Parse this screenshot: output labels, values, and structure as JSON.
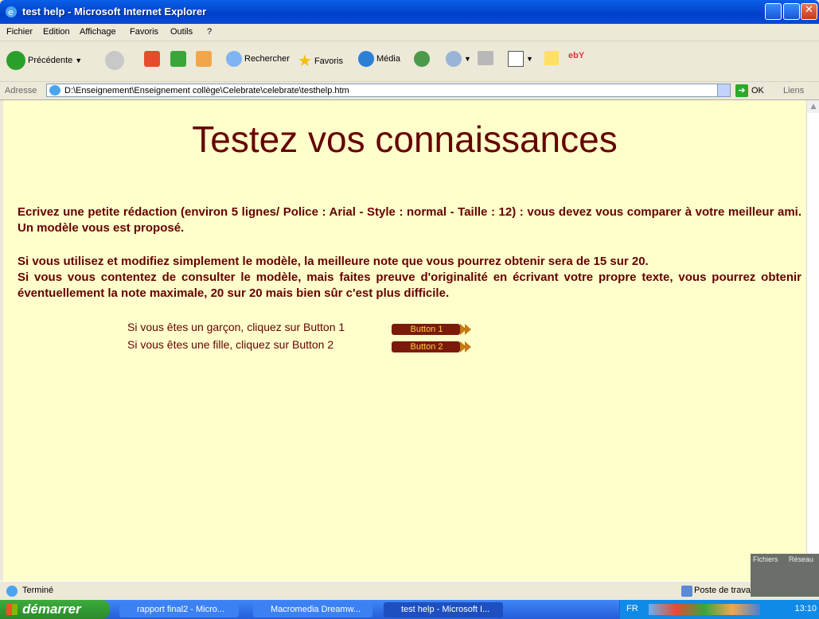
{
  "window": {
    "title": "test help - Microsoft Internet Explorer"
  },
  "menu": [
    "Fichier",
    "Edition",
    "Affichage",
    "Favoris",
    "Outils",
    "?"
  ],
  "toolbar": {
    "back_label": "Précédente",
    "search_label": "Rechercher",
    "favorites_label": "Favoris",
    "media_label": "Média",
    "ebay_label": "ebY"
  },
  "address": {
    "label": "Adresse",
    "url": "D:\\Enseignement\\Enseignement collège\\Celebrate\\celebrate\\testhelp.htm",
    "go_label": "OK",
    "links_label": "Liens"
  },
  "page": {
    "heading": "Testez vos connaissances",
    "paragraph1": "Ecrivez une petite rédaction (environ 5 lignes/ Police : Arial - Style : normal - Taille : 12) : vous devez vous comparer à votre meilleur ami. Un modèle vous est proposé.",
    "paragraph2": "Si vous utilisez et modifiez simplement le modèle, la meilleure note que vous pourrez obtenir sera de 15 sur 20.",
    "paragraph3": "Si vous vous contentez de consulter le modèle, mais faites preuve d'originalité en écrivant votre propre texte, vous pourrez obtenir éventuellement la note maximale, 20 sur 20 mais bien sûr c'est plus difficile.",
    "choices": [
      {
        "text": "Si vous êtes un garçon, cliquez sur Button 1",
        "button": "Button 1"
      },
      {
        "text": "Si vous êtes une fille, cliquez sur Button 2",
        "button": "Button 2"
      }
    ]
  },
  "status": {
    "text": "Terminé",
    "zone": "Poste de travail"
  },
  "overlay": {
    "files": "Fichiers",
    "network": "Réseau"
  },
  "taskbar": {
    "start": "démarrer",
    "tasks": [
      "rapport final2 - Micro...",
      "Macromedia Dreamw...",
      "test help - Microsoft I..."
    ],
    "lang": "FR",
    "time": "13:10"
  },
  "colors": {
    "page_background": "#ffffcc",
    "text": "#660000",
    "button_text": "#ffd040"
  }
}
